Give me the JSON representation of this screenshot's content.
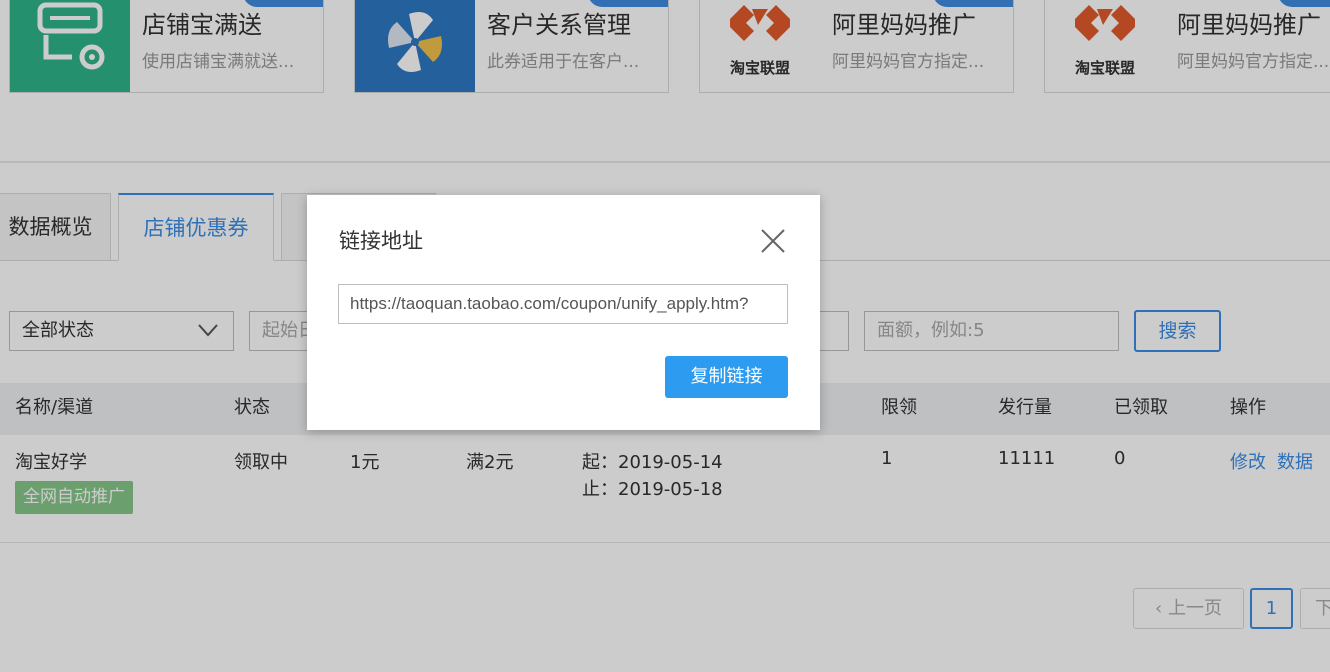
{
  "apps": [
    {
      "title": "店铺宝满送",
      "desc": "使用店铺宝满就送...",
      "icon": "shop-gift-icon"
    },
    {
      "title": "客户关系管理",
      "desc": "此券适用于在客户...",
      "icon": "crm-pinwheel-icon"
    },
    {
      "title": "阿里妈妈推广",
      "desc": "阿里妈妈官方指定...",
      "icon": "taobao-union-logo",
      "logo_text": "淘宝联盟"
    },
    {
      "title": "阿里妈妈推广",
      "desc": "阿里妈妈官方指定...",
      "icon": "taobao-union-logo",
      "logo_text": "淘宝联盟"
    }
  ],
  "tabs": [
    {
      "label": "数据概览"
    },
    {
      "label": "店铺优惠券"
    }
  ],
  "filters": {
    "status_select": "全部状态",
    "start_date_placeholder": "起始日",
    "amount_placeholder": "面额，例如:5",
    "search_label": "搜索"
  },
  "table": {
    "headers": {
      "name": "名称/渠道",
      "status": "状态",
      "limit": "限领",
      "issued": "发行量",
      "received": "已领取",
      "ops": "操作"
    },
    "row": {
      "name": "淘宝好学",
      "badge": "全网自动推广",
      "status": "领取中",
      "value": "1元",
      "condition": "满2元",
      "start": "起：2019-05-14",
      "end": "止：2019-05-18",
      "limit": "1",
      "issued": "11111",
      "received": "0",
      "edit": "修改",
      "data": "数据"
    }
  },
  "pagination": {
    "prev": "上一页",
    "current": "1",
    "next": "下"
  },
  "modal": {
    "title": "链接地址",
    "url": "https://taoquan.taobao.com/coupon/unify_apply.htm?",
    "copy_label": "复制链接"
  },
  "colors": {
    "accent": "#3a8ee6",
    "copy_button": "#2d9bf0",
    "badge": "#86c98a",
    "shop_icon_bg": "#2fb58a",
    "crm_icon_bg": "#2d78c4",
    "taobao_logo": "#e05a2b"
  }
}
